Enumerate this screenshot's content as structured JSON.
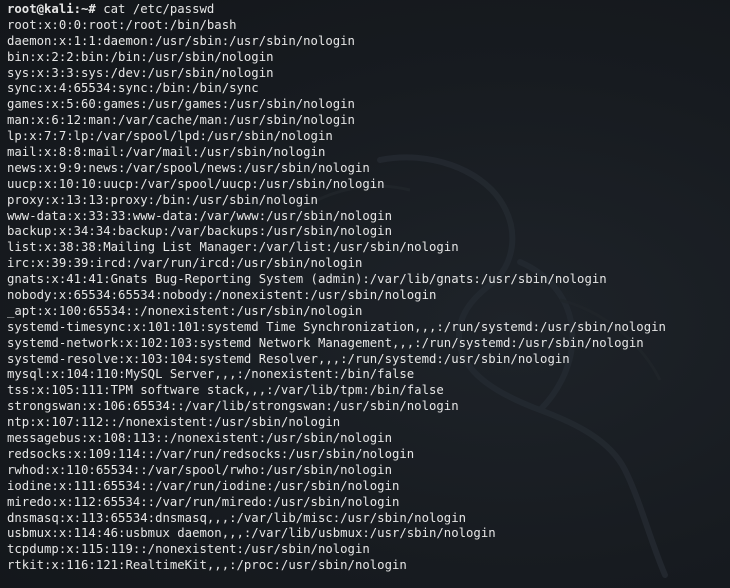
{
  "terminal": {
    "prompt": "root@kali:~#",
    "command": "cat /etc/passwd",
    "lines": [
      "root:x:0:0:root:/root:/bin/bash",
      "daemon:x:1:1:daemon:/usr/sbin:/usr/sbin/nologin",
      "bin:x:2:2:bin:/bin:/usr/sbin/nologin",
      "sys:x:3:3:sys:/dev:/usr/sbin/nologin",
      "sync:x:4:65534:sync:/bin:/bin/sync",
      "games:x:5:60:games:/usr/games:/usr/sbin/nologin",
      "man:x:6:12:man:/var/cache/man:/usr/sbin/nologin",
      "lp:x:7:7:lp:/var/spool/lpd:/usr/sbin/nologin",
      "mail:x:8:8:mail:/var/mail:/usr/sbin/nologin",
      "news:x:9:9:news:/var/spool/news:/usr/sbin/nologin",
      "uucp:x:10:10:uucp:/var/spool/uucp:/usr/sbin/nologin",
      "proxy:x:13:13:proxy:/bin:/usr/sbin/nologin",
      "www-data:x:33:33:www-data:/var/www:/usr/sbin/nologin",
      "backup:x:34:34:backup:/var/backups:/usr/sbin/nologin",
      "list:x:38:38:Mailing List Manager:/var/list:/usr/sbin/nologin",
      "irc:x:39:39:ircd:/var/run/ircd:/usr/sbin/nologin",
      "gnats:x:41:41:Gnats Bug-Reporting System (admin):/var/lib/gnats:/usr/sbin/nologin",
      "nobody:x:65534:65534:nobody:/nonexistent:/usr/sbin/nologin",
      "_apt:x:100:65534::/nonexistent:/usr/sbin/nologin",
      "systemd-timesync:x:101:101:systemd Time Synchronization,,,:/run/systemd:/usr/sbin/nologin",
      "systemd-network:x:102:103:systemd Network Management,,,:/run/systemd:/usr/sbin/nologin",
      "systemd-resolve:x:103:104:systemd Resolver,,,:/run/systemd:/usr/sbin/nologin",
      "mysql:x:104:110:MySQL Server,,,:/nonexistent:/bin/false",
      "tss:x:105:111:TPM software stack,,,:/var/lib/tpm:/bin/false",
      "strongswan:x:106:65534::/var/lib/strongswan:/usr/sbin/nologin",
      "ntp:x:107:112::/nonexistent:/usr/sbin/nologin",
      "messagebus:x:108:113::/nonexistent:/usr/sbin/nologin",
      "redsocks:x:109:114::/var/run/redsocks:/usr/sbin/nologin",
      "rwhod:x:110:65534::/var/spool/rwho:/usr/sbin/nologin",
      "iodine:x:111:65534::/var/run/iodine:/usr/sbin/nologin",
      "miredo:x:112:65534::/var/run/miredo:/usr/sbin/nologin",
      "dnsmasq:x:113:65534:dnsmasq,,,:/var/lib/misc:/usr/sbin/nologin",
      "usbmux:x:114:46:usbmux daemon,,,:/var/lib/usbmux:/usr/sbin/nologin",
      "tcpdump:x:115:119::/nonexistent:/usr/sbin/nologin",
      "rtkit:x:116:121:RealtimeKit,,,:/proc:/usr/sbin/nologin"
    ]
  },
  "colors": {
    "background": "#161a1f",
    "text": "#e6e6e6",
    "logo": "#2a3038"
  },
  "icons": {
    "wallpaper": "kali-dragon-logo-icon"
  }
}
